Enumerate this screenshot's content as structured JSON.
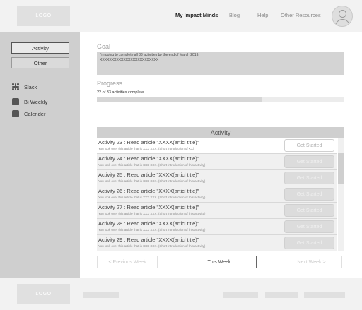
{
  "header": {
    "logo": "LOGO",
    "nav": [
      "My Impact Minds",
      "Blog",
      "Help",
      "Other Resources"
    ],
    "active_nav": "My Impact Minds"
  },
  "sidebar": {
    "tabs": [
      "Activity",
      "Other"
    ],
    "items": [
      {
        "label": "Slack",
        "icon": "slack-icon"
      },
      {
        "label": "Bi Weekly",
        "icon": "square-icon"
      },
      {
        "label": "Calender",
        "icon": "square-icon"
      }
    ]
  },
  "goal": {
    "title": "Goal",
    "text_line1": "I'm going to complete all 33 activities by the end of March 2019.",
    "text_line2": "XXXXXXXXXXXXXXXXXXXXXXXXX"
  },
  "progress": {
    "title": "Progress",
    "text": "22 of 33 activities complete",
    "completed": 22,
    "total": 33
  },
  "activity": {
    "header": "Activity",
    "rows": [
      {
        "title": "Activity 23 : Read article \"XXXX(articl title)\"",
        "sub": "You look over this article that is XXX XXX. (Short introduction of XX)",
        "button": "Get Started"
      },
      {
        "title": "Activity 24 : Read article \"XXXX(articl title)\"",
        "sub": "You look over this article that is XXX XXX. (Short introduction of this activity)",
        "button": "Get Started"
      },
      {
        "title": "Activity 25 : Read article \"XXXX(articl title)\"",
        "sub": "You look over this article that is XXX XXX. (Short introduction of this activity)",
        "button": "Get Started"
      },
      {
        "title": "Activity 26 : Read article \"XXXX(articl title)\"",
        "sub": "You look over this article that is XXX XXX. (Short introduction of this activity)",
        "button": "Get Started"
      },
      {
        "title": "Activity 27 : Read article \"XXXX(articl title)\"",
        "sub": "You look over this article that is XXX XXX. (Short introduction of this activity)",
        "button": "Get Started"
      },
      {
        "title": "Activity 28 : Read article \"XXXX(articl title)\"",
        "sub": "You look over this article that is XXX XXX. (Short introduction of this activity)",
        "button": "Get Started"
      },
      {
        "title": "Activity 29 : Read article \"XXXX(articl title)\"",
        "sub": "You look over this article that is XXX XXX. (Short introduction of this activity)",
        "button": "Get Started"
      }
    ]
  },
  "week_nav": {
    "prev": "< Previous Week",
    "current": "This Week",
    "next": "Next Week >"
  },
  "footer": {
    "logo": "LOGO"
  }
}
